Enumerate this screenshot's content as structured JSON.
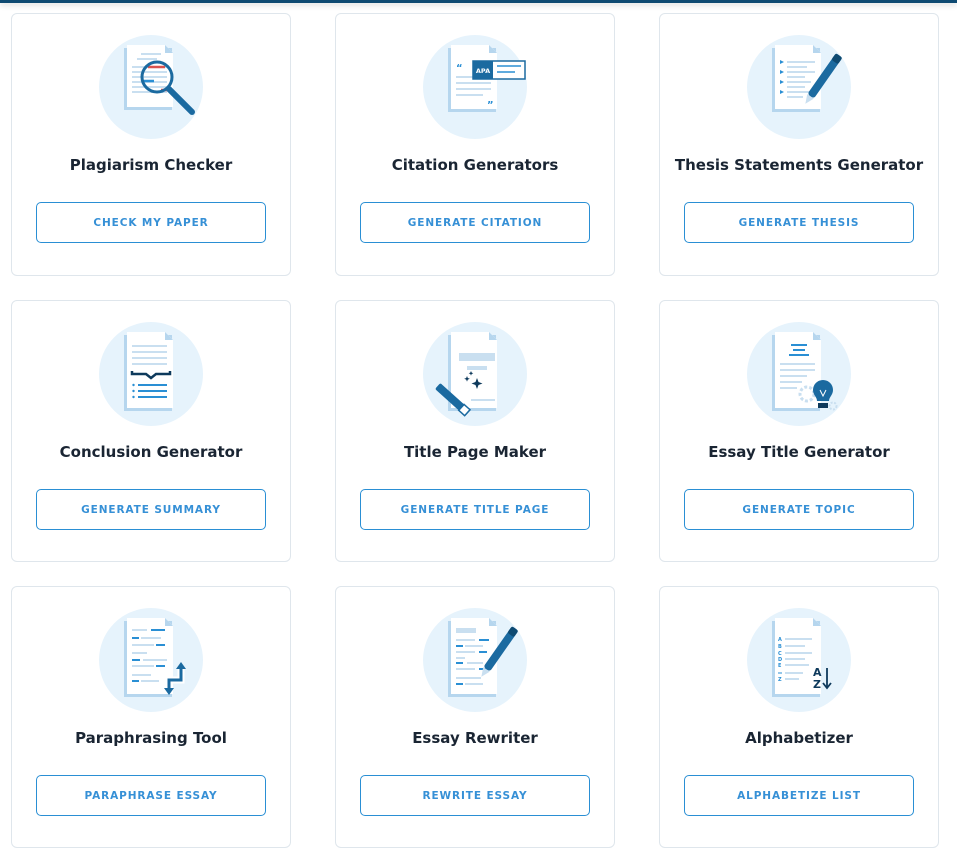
{
  "colors": {
    "topbar": "#0e4a72",
    "accent": "#2a8fd4",
    "illustration_bg": "#e6f3fc",
    "title_text": "#1a2533"
  },
  "tools": [
    {
      "title": "Plagiarism Checker",
      "button": "CHECK MY PAPER",
      "icon": "magnifier-document-icon"
    },
    {
      "title": "Citation Generators",
      "button": "GENERATE CITATION",
      "icon": "citation-apa-document-icon",
      "badge": "APA"
    },
    {
      "title": "Thesis Statements Generator",
      "button": "GENERATE THESIS",
      "icon": "pen-document-icon"
    },
    {
      "title": "Conclusion Generator",
      "button": "GENERATE SUMMARY",
      "icon": "summary-brace-document-icon"
    },
    {
      "title": "Title Page Maker",
      "button": "GENERATE TITLE PAGE",
      "icon": "magic-wand-document-icon"
    },
    {
      "title": "Essay Title Generator",
      "button": "GENERATE TOPIC",
      "icon": "lightbulb-document-icon"
    },
    {
      "title": "Paraphrasing Tool",
      "button": "PARAPHRASE ESSAY",
      "icon": "swap-arrows-document-icon"
    },
    {
      "title": "Essay Rewriter",
      "button": "REWRITE ESSAY",
      "icon": "pen-rewrite-document-icon"
    },
    {
      "title": "Alphabetizer",
      "button": "ALPHABETIZE LIST",
      "icon": "az-sort-document-icon",
      "letters": "A B C D E Z"
    }
  ]
}
